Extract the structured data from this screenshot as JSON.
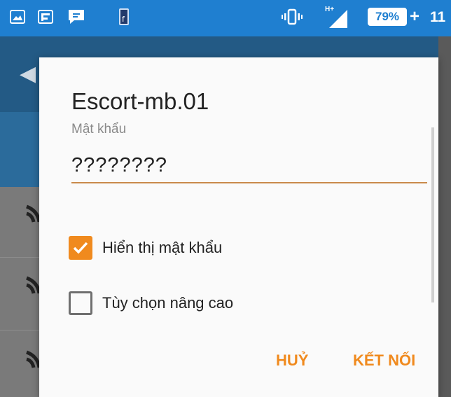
{
  "status_bar": {
    "network_type": "H+",
    "battery_percent": "79%",
    "charging_symbol": "+",
    "time": "11",
    "icons": [
      "image-icon",
      "flipboard-icon",
      "chat-icon",
      "facebook-icon",
      "vibrate-icon",
      "signal-icon",
      "battery-icon"
    ],
    "color": "#1f7fd0"
  },
  "dialog": {
    "title": "Escort-mb.01",
    "password_label": "Mật khẩu",
    "password_value": "????????",
    "show_password": {
      "label": "Hiển thị mật khẩu",
      "checked": true
    },
    "advanced_options": {
      "label": "Tùy chọn nâng cao",
      "checked": false
    },
    "cancel_label": "HUỶ",
    "connect_label": "KẾT NỐI",
    "accent_color": "#f08a1e"
  }
}
